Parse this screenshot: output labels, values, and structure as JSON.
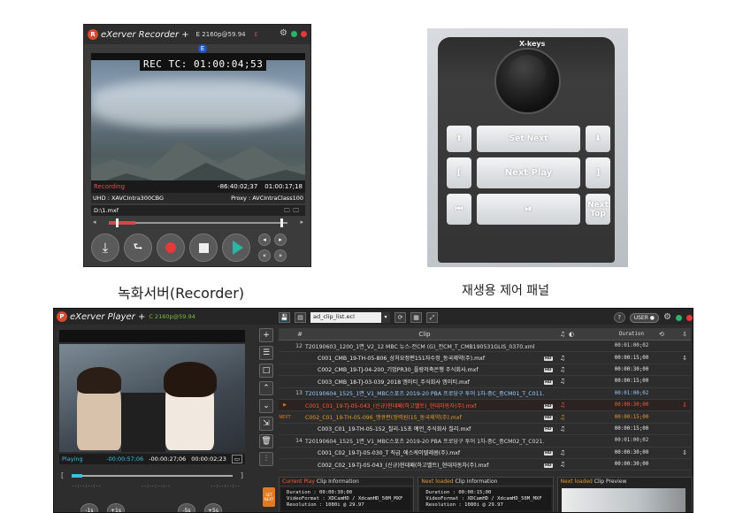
{
  "recorder": {
    "app_name": "eXVerver Recorder",
    "app_name_x": "e",
    "app_name_rest": "Xerver Recorder",
    "plus": "+",
    "format": "E 2160p@59.94",
    "flag": "E",
    "timecode_overlay": "REC TC: 01:00:04;53",
    "status_label": "Recording",
    "time_remaining": "-86:40:02;37",
    "time_elapsed": "01:00:17;18",
    "uhd_label": "UHD : XAVCIntra300CBG",
    "proxy_label": "Proxy : AVCIntraClass100",
    "file_path": "D:\\1.mxf",
    "colors": {
      "accent": "#d24b2a",
      "record": "#e83838",
      "play": "#2cb5a4"
    }
  },
  "panel": {
    "brand": "X-keys",
    "keys": {
      "up": "⬆",
      "set_next": "Set Next",
      "down": "⬇",
      "bracket_left": "[",
      "next_play": "Next Play",
      "bracket_right": "]",
      "prev": "⏮",
      "play_pause": "⏯",
      "next_top": "Next Top"
    }
  },
  "captions": {
    "recorder": "녹화서버(Recorder)",
    "panel": "재생용 제어 패널"
  },
  "player": {
    "app_name_rest": "Xerver Player",
    "format": "C 2160p@59.94",
    "status_label": "Playing",
    "time_remaining": "-00:00:57;06",
    "time_total": "-00:00:27;06",
    "timecode": "00:00:02;23",
    "scrub_marks": [
      "--:--:--:--",
      "--:--:--:--",
      "--:--:--:--"
    ],
    "jog_buttons": [
      "-1s",
      "+1s",
      "-5s",
      "+5s"
    ],
    "next_button": "SET NEXT",
    "playlist_file": "ad_clip_list.ecl",
    "user_label": "USER",
    "table": {
      "headers": {
        "num": "#",
        "clip": "Clip",
        "duration": "Duration"
      },
      "rows": [
        {
          "type": "group",
          "num": "12",
          "clip": "T20190603_1200_1면_V2_12 MBC 뉴스-전CM (G)_전CM_T_CMB190531GLIS_0370.xml",
          "duration": "00:01:00;02"
        },
        {
          "type": "sub",
          "clip": "C001_CMB_19-TH-05-806_상처요정편151자수정_동국제약(주).mxf",
          "duration": "00:00:15;00",
          "hd": "HD"
        },
        {
          "type": "sub",
          "clip": "C002_CMB_19-TJ-04-200_기업PR30_플랑저축은행 주식회사.mxf",
          "duration": "00:00:30;00",
          "hd": "HD"
        },
        {
          "type": "sub",
          "clip": "C003_CMB_18-TJ-03-039_2018 엠이티_주식회사 엠이티.mxf",
          "duration": "00:00:15;00",
          "hd": "HD"
        },
        {
          "type": "group-blue",
          "num": "13",
          "clip": "T20190604_1525_1면_V1_MBC스포츠 2019-20 PBA 프로당구 투어 1차-중C_중CM01_T_C011...",
          "duration": "00:01:00;02"
        },
        {
          "type": "current",
          "mark": "▶",
          "clip": "C001_C01_19-TJ-05-043_(신규)현대패(하고벨트)_현대자동차(주).mxf",
          "duration": "00:00:30;00",
          "hd": "HD"
        },
        {
          "type": "next",
          "mark": "NEXT",
          "clip": "C002_C01_19-TH-05-096_맹큐편(정력원)15_동국제약(주).mxf",
          "duration": "00:00:15;00",
          "hd": "HD"
        },
        {
          "type": "sub",
          "clip": "C003_C01_19-TH-05-152_칠리-15초 예언_주식회사 칠리.mxf",
          "duration": "00:00:15;00",
          "hd": "HD"
        },
        {
          "type": "group",
          "num": "14",
          "clip": "T20190604_1525_1면_V1_MBC스포츠 2019-20 PBA 프로당구 투어 1차-중C_중CM02_T_C021...",
          "duration": "00:01:00;02"
        },
        {
          "type": "sub",
          "clip": "C001_C02_19-TJ-05-030_T 직급_에스케이텔레콤(주).mxf",
          "duration": "00:00:30;00",
          "hd": "HD"
        },
        {
          "type": "sub",
          "clip": "C002_C02_19-TJ-05-043_(신규)현대패(하고벨트)_현대자동차(주).mxf",
          "duration": "00:00:30;00",
          "hd": "HD"
        }
      ]
    },
    "info": {
      "current_prefix": "Current Play",
      "current_title": " Clip Information",
      "current_lines": [
        "Duration   : 00:00:30;00",
        "VideoFormat : XDCamHD / XdcamHD_50M_MXF",
        "Resolution : 1080i @ 29.97"
      ],
      "next_prefix": "Next loaded",
      "next_title": " Clip Information",
      "next_lines": [
        "Duration   : 00:00:15;00",
        "VideoFormat : XDCamHD / XdcamHD_50M_MXF",
        "Resolution : 1080i @ 29.97"
      ],
      "preview_prefix": "Next loaded",
      "preview_title": " Clip Preview"
    }
  }
}
